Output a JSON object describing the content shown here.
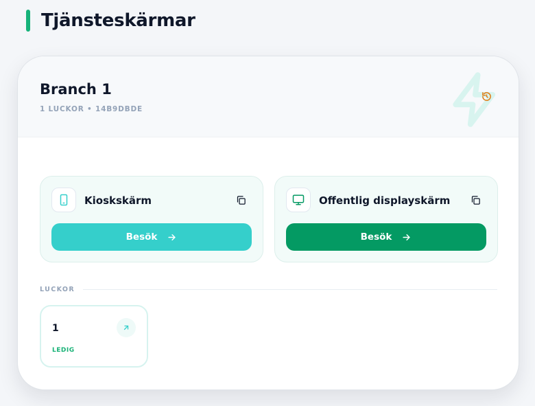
{
  "page": {
    "title": "Tjänsteskärmar"
  },
  "branch": {
    "name": "Branch 1",
    "meta": "1 LUCKOR • 14B9DBDE"
  },
  "screens": [
    {
      "title": "Kioskskärm",
      "icon": "tablet-icon",
      "visit_label": "Besök",
      "accent": "#35cfcb"
    },
    {
      "title": "Offentlig displayskärm",
      "icon": "monitor-icon",
      "visit_label": "Besök",
      "accent": "#049a63"
    }
  ],
  "slots_section": {
    "label": "LUCKOR",
    "slots": [
      {
        "number": "1",
        "status": "LEDIG"
      }
    ]
  },
  "colors": {
    "accent_green": "#16b27a",
    "status_free": "#17b276",
    "refresh_orange": "#e07b12"
  }
}
